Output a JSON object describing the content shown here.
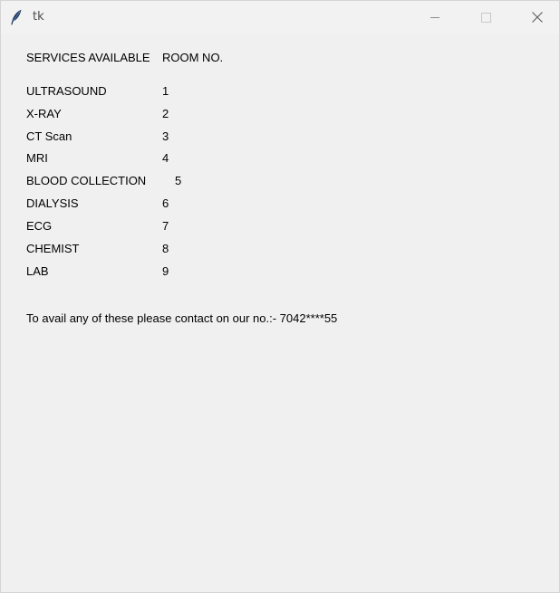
{
  "window": {
    "title": "tk",
    "icon": "feather-icon",
    "controls": [
      "minimize-icon",
      "maximize-icon",
      "close-icon"
    ]
  },
  "header": {
    "services_label": "SERVICES AVAILABLE",
    "room_label": "ROOM NO."
  },
  "services": [
    {
      "name": "ULTRASOUND",
      "room": "1"
    },
    {
      "name": "X-RAY",
      "room": "2"
    },
    {
      "name": "CT Scan",
      "room": "3"
    },
    {
      "name": "MRI",
      "room": "4"
    },
    {
      "name": "BLOOD COLLECTION",
      "room": "5"
    },
    {
      "name": "DIALYSIS",
      "room": "6"
    },
    {
      "name": "ECG",
      "room": "7"
    },
    {
      "name": "CHEMIST",
      "room": "8"
    },
    {
      "name": "LAB",
      "room": "9"
    }
  ],
  "footer": {
    "contact_text": "To avail any of these please contact on our no.:- 7042****55"
  }
}
